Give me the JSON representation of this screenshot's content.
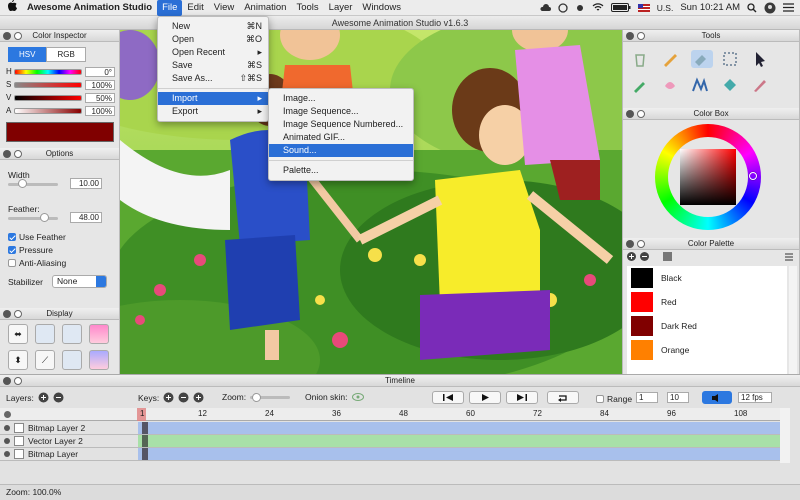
{
  "menubar": {
    "app_name": "Awesome Animation Studio",
    "items": [
      "File",
      "Edit",
      "View",
      "Animation",
      "Tools",
      "Layer",
      "Windows"
    ],
    "input_source": "U.S.",
    "clock": "Sun 10:21 AM"
  },
  "window": {
    "title": "Awesome Animation Studio v1.6.3"
  },
  "file_menu": {
    "items": [
      {
        "label": "New",
        "shortcut": "⌘N"
      },
      {
        "label": "Open",
        "shortcut": "⌘O"
      },
      {
        "label": "Open Recent",
        "shortcut": "▸"
      },
      {
        "label": "Save",
        "shortcut": "⌘S"
      },
      {
        "label": "Save As...",
        "shortcut": "⇧⌘S"
      },
      {
        "label": "Import",
        "shortcut": "▸"
      },
      {
        "label": "Export",
        "shortcut": "▸"
      }
    ]
  },
  "import_menu": {
    "items": [
      "Image...",
      "Image Sequence...",
      "Image Sequence Numbered...",
      "Animated GIF...",
      "Sound...",
      "Palette..."
    ],
    "highlighted": "Sound..."
  },
  "color_inspector": {
    "title": "Color Inspector",
    "modes": [
      "HSV",
      "RGB"
    ],
    "active_mode": "HSV",
    "rows": [
      {
        "label": "H",
        "value": "0°"
      },
      {
        "label": "S",
        "value": "100%"
      },
      {
        "label": "V",
        "value": "50%"
      },
      {
        "label": "A",
        "value": "100%"
      }
    ],
    "current_color": "#800000"
  },
  "options": {
    "title": "Options",
    "width_label": "Width",
    "width_value": "10.00",
    "feather_label": "Feather:",
    "feather_value": "48.00",
    "use_feather": "Use Feather",
    "pressure": "Pressure",
    "anti_aliasing": "Anti-Aliasing",
    "stabilizer_label": "Stabilizer",
    "stabilizer_value": "None"
  },
  "display": {
    "title": "Display"
  },
  "tools": {
    "title": "Tools"
  },
  "color_box": {
    "title": "Color Box"
  },
  "color_palette": {
    "title": "Color Palette",
    "colors": [
      {
        "name": "Black",
        "hex": "#000000"
      },
      {
        "name": "Red",
        "hex": "#ff0000"
      },
      {
        "name": "Dark Red",
        "hex": "#800000"
      },
      {
        "name": "Orange",
        "hex": "#ff8000"
      }
    ]
  },
  "timeline": {
    "title": "Timeline",
    "layers_label": "Layers:",
    "keys_label": "Keys:",
    "zoom_label": "Zoom:",
    "onion_label": "Onion skin:",
    "range_label": "Range",
    "range_start": "1",
    "range_end": "10",
    "fps": "12 fps",
    "ruler_ticks": [
      "1",
      "12",
      "24",
      "36",
      "48",
      "60",
      "72",
      "84",
      "96",
      "108"
    ],
    "layers": [
      {
        "name": "Bitmap Layer 2",
        "color": "#a8c0ec"
      },
      {
        "name": "Vector Layer 2",
        "color": "#a8e0a8"
      },
      {
        "name": "Bitmap Layer",
        "color": "#a8c0ec"
      }
    ]
  },
  "status": {
    "zoom": "Zoom: 100.0%"
  }
}
